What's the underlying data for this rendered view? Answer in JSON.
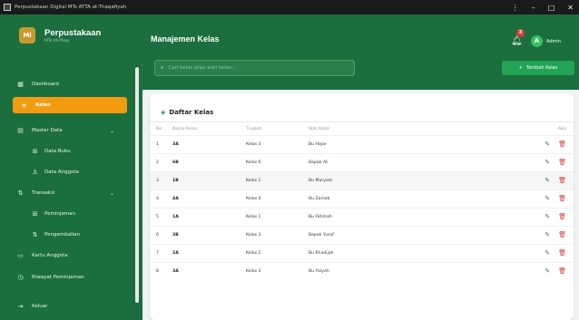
{
  "window": {
    "title": "Perpustakaan Digital MTs ATTA at-Thaqafiyah",
    "minimize": "–",
    "maximize": "□",
    "close": "✕",
    "menu": "⋮"
  },
  "sidebar": {
    "brand": {
      "logo": "Mi",
      "name": "Perpustakaan",
      "subtitle": "MTs At-Thaq"
    },
    "items": [
      {
        "label": "Dashboard",
        "icon": "grid-icon"
      },
      {
        "label": "Kelas",
        "icon": "layers-icon",
        "active": true
      },
      {
        "label": "Master Data",
        "icon": "database-icon",
        "expandable": true
      },
      {
        "label": "Data Buku",
        "icon": "book-icon",
        "sub": true
      },
      {
        "label": "Data Anggota",
        "icon": "users-icon",
        "sub": true
      },
      {
        "label": "Transaksi",
        "icon": "swap-icon",
        "expandable": true
      },
      {
        "label": "Peminjaman",
        "icon": "borrow-icon",
        "sub": true
      },
      {
        "label": "Pengembalian",
        "icon": "return-icon",
        "sub": true
      },
      {
        "label": "Kartu Anggota",
        "icon": "card-icon"
      },
      {
        "label": "Riwayat Peminjaman",
        "icon": "history-icon"
      },
      {
        "label": "Keluar",
        "icon": "logout-icon"
      }
    ]
  },
  "header": {
    "title": "Manajemen Kelas",
    "notification_count": "3",
    "avatar_initial": "A",
    "user_name": "Admin"
  },
  "search": {
    "placeholder": "Cari kelas atau wali kelas...",
    "value": ""
  },
  "add_button": {
    "label": "Tambah Kelas",
    "icon": "+"
  },
  "card": {
    "title": "Daftar Kelas",
    "columns": {
      "no": "No",
      "name": "Nama Kelas",
      "level": "Tingkat",
      "teacher": "Wali Kelas",
      "action": "Aksi"
    },
    "rows": [
      {
        "no": "1",
        "name": "3A",
        "level": "Kelas 3",
        "teacher": "Bu Hajar"
      },
      {
        "no": "2",
        "name": "6B",
        "level": "Kelas 6",
        "teacher": "Bapak Ali"
      },
      {
        "no": "3",
        "name": "1B",
        "level": "Kelas 1",
        "teacher": "Bu Maryam"
      },
      {
        "no": "4",
        "name": "4A",
        "level": "Kelas 4",
        "teacher": "Bu Zainab"
      },
      {
        "no": "5",
        "name": "1A",
        "level": "Kelas 1",
        "teacher": "Bu Fatimah"
      },
      {
        "no": "6",
        "name": "3B",
        "level": "Kelas 3",
        "teacher": "Bapak Yusuf"
      },
      {
        "no": "7",
        "name": "2A",
        "level": "Kelas 2",
        "teacher": "Bu Khadijah"
      },
      {
        "no": "8",
        "name": "3A",
        "level": "Kelas 3",
        "teacher": "Bu Aisyah"
      }
    ]
  },
  "colors": {
    "sidebar": "#1b6e3d",
    "accent": "#f39c12",
    "primary": "#22a455",
    "danger": "#d93b3b"
  }
}
